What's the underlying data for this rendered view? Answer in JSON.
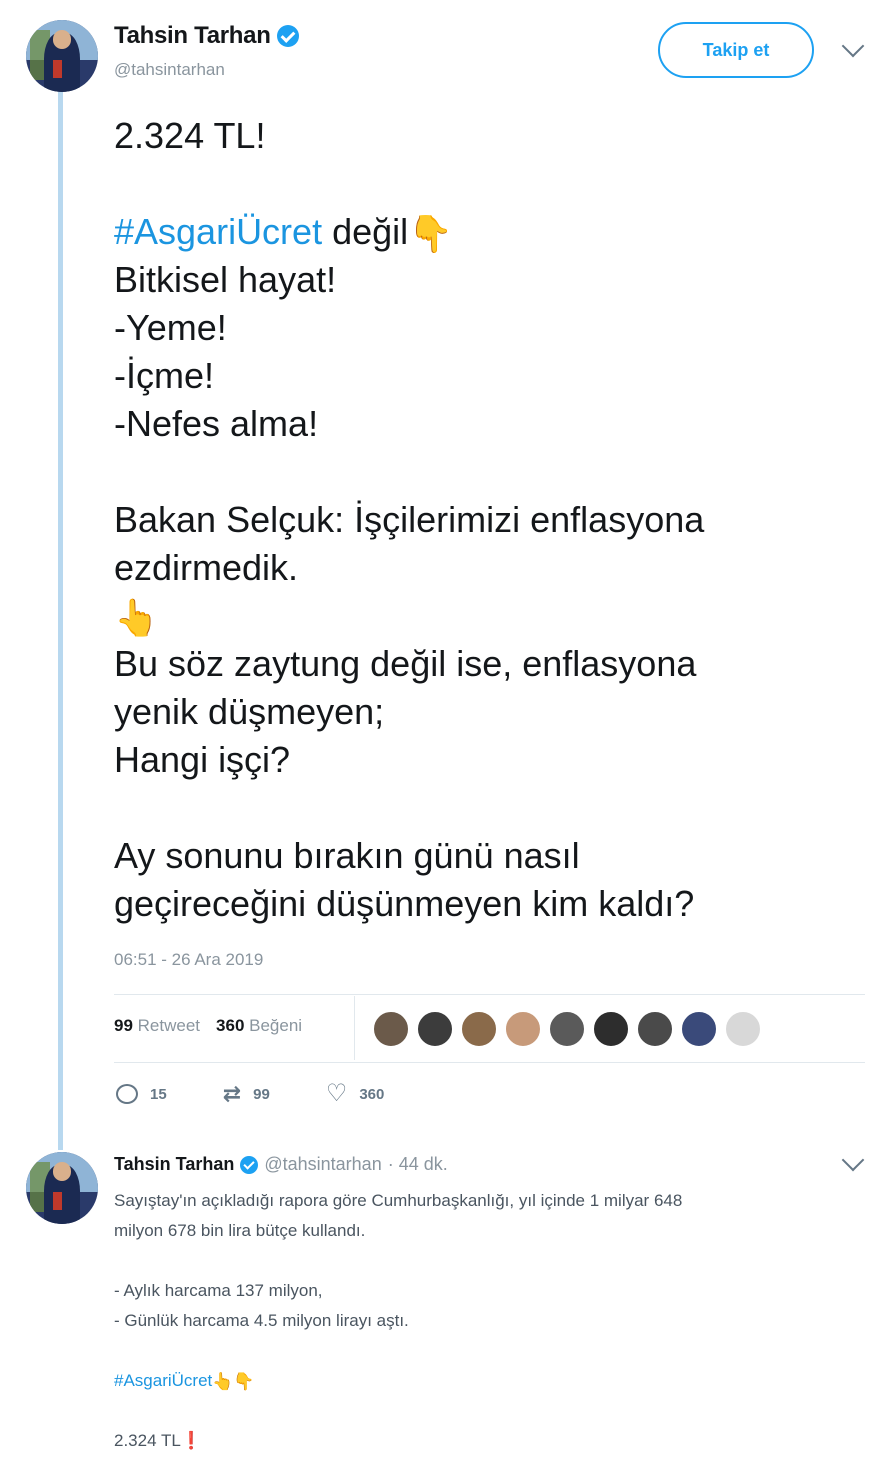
{
  "tweet": {
    "author_name": "Tahsin Tarhan",
    "handle": "@tahsintarhan",
    "follow_label": "Takip et",
    "lines": [
      {
        "text": "2.324 TL!"
      },
      {
        "text": ""
      },
      {
        "hashtag": "#AsgariÜcret",
        "text": " değil",
        "emoji": "👇"
      },
      {
        "text": "Bitkisel hayat!"
      },
      {
        "text": "-Yeme!"
      },
      {
        "text": "-İçme!"
      },
      {
        "text": "-Nefes alma!"
      },
      {
        "text": ""
      },
      {
        "text": "Bakan Selçuk: İşçilerimizi enflasyona"
      },
      {
        "text": "ezdirmedik."
      },
      {
        "emoji": "👆"
      },
      {
        "text": "Bu söz zaytung değil ise, enflasyona"
      },
      {
        "text": "yenik düşmeyen;"
      },
      {
        "text": "Hangi işçi?"
      },
      {
        "text": ""
      },
      {
        "text": "Ay sonunu bırakın günü nasıl"
      },
      {
        "text": "geçireceğini düşünmeyen kim kaldı?"
      }
    ],
    "timestamp": "06:51 - 26 Ara 2019",
    "retweet_count": "99",
    "retweet_label": "Retweet",
    "like_count": "360",
    "like_label": "Beğeni",
    "likers": [
      "#6b5a4a",
      "#3c3c3c",
      "#8a6a4a",
      "#c79a7a",
      "#5a5a5a",
      "#2d2d2d",
      "#4a4a4a",
      "#3a4a7a",
      "#d8d8d8"
    ],
    "actions": {
      "replies": "15",
      "retweets": "99",
      "likes": "360"
    }
  },
  "reply": {
    "author_name": "Tahsin Tarhan",
    "handle": "@tahsintarhan",
    "time": "· 44 dk.",
    "lines": [
      {
        "text": "Sayıştay'ın açıkladığı rapora göre  Cumhurbaşkanlığı, yıl içinde 1 milyar 648"
      },
      {
        "text": "milyon 678 bin lira bütçe kullandı."
      },
      {
        "text": ""
      },
      {
        "text": "- Aylık harcama 137 milyon,"
      },
      {
        "text": "- Günlük harcama 4.5 milyon lirayı aştı."
      },
      {
        "text": ""
      },
      {
        "hashtag": "#AsgariÜcret",
        "emoji": " 👆👇"
      },
      {
        "text": ""
      },
      {
        "text": "2.324 TL",
        "excl": "❗"
      }
    ]
  },
  "colors": {
    "accent": "#1da1f2",
    "hashtag": "#1b95e0",
    "thread_line": "#b8d8ef",
    "muted": "#8a959e"
  },
  "icons": {
    "verified": "verified-badge-icon",
    "more": "chevron-down-icon",
    "reply": "reply-icon",
    "retweet": "retweet-icon",
    "like": "heart-icon"
  }
}
